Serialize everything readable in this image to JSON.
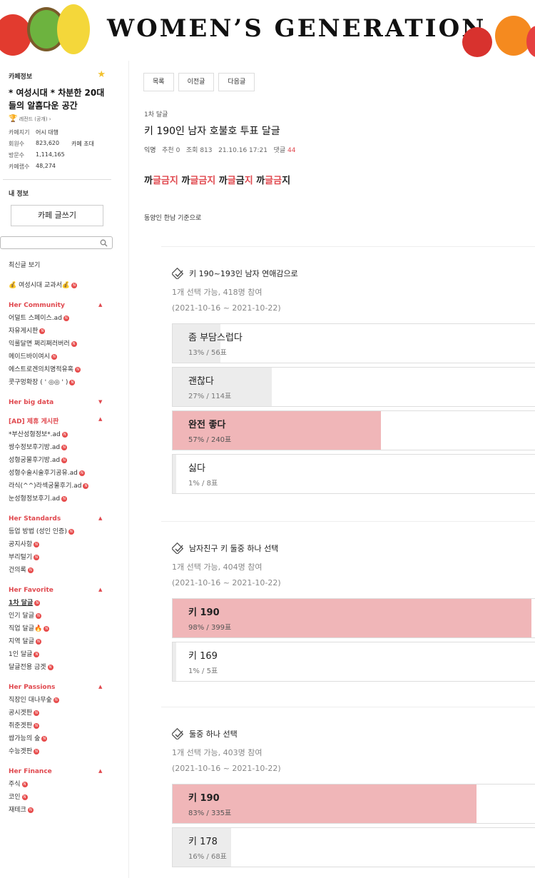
{
  "banner": {
    "title": "WOMEN’S GENERATION"
  },
  "sidebar": {
    "cafe_info_label": "카페정보",
    "cafe_name": "* 여성시대 * 차분한 20대들의 알흠다운 공간",
    "level": "레전드 (공개)",
    "rows": [
      {
        "k": "카페지기",
        "v": "어시 대행",
        "extra": ""
      },
      {
        "k": "회원수",
        "v": "823,620",
        "extra": "카페 초대"
      },
      {
        "k": "방문수",
        "v": "1,114,165",
        "extra": ""
      },
      {
        "k": "카페랩수",
        "v": "48,274",
        "extra": ""
      }
    ],
    "my_info": "내 정보",
    "write_button": "카페 글쓰기",
    "recent": "최신글 보기",
    "textbook": "💰 여성시대 교과서💰",
    "groups": [
      {
        "title": "Her Community",
        "arrow": "▲",
        "items": [
          "어덜트 스페이스.ad",
          "자유게시판",
          "익룰달면 쩌리쩌러버러",
          "메이드바이여시",
          "에스트로겐의치명적유혹",
          "콧구멍확장 ( ' ◎◎ ' )"
        ]
      },
      {
        "title": "Her big data",
        "arrow": "▼",
        "items": []
      },
      {
        "title": "[AD] 제휴 게시판",
        "arrow": "▲",
        "items": [
          "*부산성형정보*.ad",
          "쌍수정보후기방.ad",
          "성형궁물후기방.ad",
          "성형수술시술후기공유.ad",
          "라식(^^)라섹궁물후기.ad",
          "눈성형정보후기.ad"
        ]
      },
      {
        "title": "Her Standards",
        "arrow": "▲",
        "items": [
          "등업 방법 (성인 인증)",
          "공지사항",
          "부리털기",
          "건의록"
        ]
      },
      {
        "title": "Her Favorite",
        "arrow": "▲",
        "items": [
          "1차 달글",
          "인기 달글",
          "직업 달글🔥",
          "지역 달글",
          "1인 달글",
          "달글전용 금겟"
        ]
      },
      {
        "title": "Her Passions",
        "arrow": "▲",
        "items": [
          "직장인 대나무숲",
          "공시겟판",
          "취준겟판",
          "쌉가능의 숲",
          "수능겟판"
        ]
      },
      {
        "title": "Her Finance",
        "arrow": "▲",
        "items": [
          "주식",
          "코인",
          "재테크"
        ]
      }
    ]
  },
  "nav": {
    "list": "목록",
    "prev": "이전글",
    "next": "다음글"
  },
  "post": {
    "category": "1차 달글",
    "title": "키 190인 남자 호불호 투표 달글",
    "author": "익명",
    "recommend": "추천 0",
    "views": "조회 813",
    "datetime": "21.10.16 17:21",
    "comments_label": "댓글",
    "comments": "44",
    "headline": [
      {
        "t": "까",
        "c": ""
      },
      {
        "t": "글금지",
        "c": "pk"
      },
      {
        "t": " 까",
        "c": ""
      },
      {
        "t": "글금지",
        "c": "pk"
      },
      {
        "t": " 까",
        "c": ""
      },
      {
        "t": "글",
        "c": "pk"
      },
      {
        "t": "금",
        "c": ""
      },
      {
        "t": "지",
        "c": "pk"
      },
      {
        "t": " 까",
        "c": ""
      },
      {
        "t": "글금",
        "c": "pk"
      },
      {
        "t": "지",
        "c": ""
      }
    ],
    "body": "동양인 한남 기준으로"
  },
  "polls": [
    {
      "question": "키 190~193인 남자 연애감으로",
      "info": "1개 선택 가능, 418명 참여",
      "period": "(2021-10-16 ~ 2021-10-22)",
      "options": [
        {
          "label": "좀 부담스럽다",
          "result": "13% / 56표",
          "pct": 13,
          "win": false
        },
        {
          "label": "괜찮다",
          "result": "27% / 114표",
          "pct": 27,
          "win": false
        },
        {
          "label": "완전 좋다",
          "result": "57% / 240표",
          "pct": 57,
          "win": true
        },
        {
          "label": "싫다",
          "result": "1% / 8표",
          "pct": 1,
          "win": false
        }
      ]
    },
    {
      "question": "남자친구 키 둘중 하나 선택",
      "info": "1개 선택 가능, 404명 참여",
      "period": "(2021-10-16 ~ 2021-10-22)",
      "options": [
        {
          "label": "키 190",
          "result": "98% / 399표",
          "pct": 98,
          "win": true
        },
        {
          "label": "키 169",
          "result": "1% / 5표",
          "pct": 1,
          "win": false
        }
      ]
    },
    {
      "question": "둘중 하나 선택",
      "info": "1개 선택 가능, 403명 참여",
      "period": "(2021-10-16 ~ 2021-10-22)",
      "options": [
        {
          "label": "키 190",
          "result": "83% / 335표",
          "pct": 83,
          "win": true
        },
        {
          "label": "키 178",
          "result": "16% / 68표",
          "pct": 16,
          "win": false
        }
      ]
    }
  ]
}
